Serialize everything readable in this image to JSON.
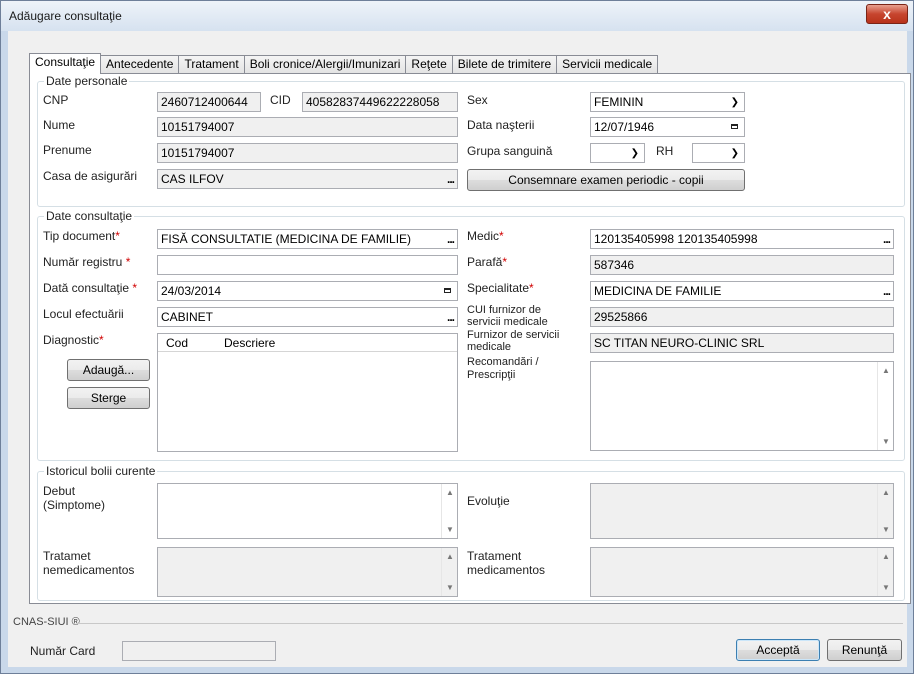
{
  "window": {
    "title": "Adăugare consultaţie",
    "close_label": "x"
  },
  "tabs": [
    "Consultaţie",
    "Antecedente",
    "Tratament",
    "Boli cronice/Alergii/Imunizari",
    "Reţete",
    "Bilete de trimitere",
    "Servicii medicale"
  ],
  "personal": {
    "legend": "Date personale",
    "cnp_label": "CNP",
    "cnp_value": "2460712400644",
    "cid_label": "CID",
    "cid_value": "40582837449622228058",
    "nume_label": "Nume",
    "nume_value": "10151794007",
    "prenume_label": "Prenume",
    "prenume_value": "10151794007",
    "casa_label": "Casa de asigurări",
    "casa_value": "CAS ILFOV",
    "sex_label": "Sex",
    "sex_value": "FEMININ",
    "data_nasterii_label": "Data naşterii",
    "data_nasterii_value": "12/07/1946",
    "grupa_label": "Grupa sanguină",
    "grupa_value": "",
    "rh_label": "RH",
    "rh_value": "",
    "consemnare_button": "Consemnare examen periodic - copii"
  },
  "consultatie": {
    "legend": "Date consultaţie",
    "tip_document_label": "Tip document",
    "tip_document_value": "FISĂ CONSULTATIE (MEDICINA DE FAMILIE)",
    "numar_registru_label": "Număr registru",
    "numar_registru_value": "",
    "data_consultatie_label": "Dată consultaţie",
    "data_consultatie_value": "24/03/2014",
    "locul_label": "Locul efectuării",
    "locul_value": "CABINET",
    "diagnostic_label": "Diagnostic",
    "adauga_button": "Adaugă...",
    "sterge_button": "Sterge",
    "grid_cols": [
      "Cod",
      "Descriere"
    ],
    "medic_label": "Medic",
    "medic_value": "120135405998 120135405998",
    "parafa_label": "Parafă",
    "parafa_value": "587346",
    "specialitate_label": "Specialitate",
    "specialitate_value": "MEDICINA DE FAMILIE",
    "cui_label_1": "CUI furnizor de",
    "cui_label_2": "servicii medicale",
    "cui_value": "29525866",
    "furnizor_label_1": "Furnizor de servicii",
    "furnizor_label_2": "medicale",
    "furnizor_value": "SC TITAN NEURO-CLINIC SRL",
    "recomandari_label_1": "Recomandări /",
    "recomandari_label_2": "Prescripţii"
  },
  "istoric": {
    "legend": "Istoricul bolii curente",
    "debut_label_1": "Debut",
    "debut_label_2": "(Simptome)",
    "evolutie_label": "Evoluţie",
    "tratamet_nemed_label_1": "Tratamet",
    "tratamet_nemed_label_2": "nemedicamentos",
    "tratament_med_label_1": "Tratament",
    "tratament_med_label_2": "medicamentos"
  },
  "footer": {
    "siui_label": "CNAS-SIUI ®",
    "numar_card_label": "Număr Card",
    "numar_card_value": "",
    "accepta_button": "Acceptă",
    "renunta_button": "Renunţă"
  }
}
